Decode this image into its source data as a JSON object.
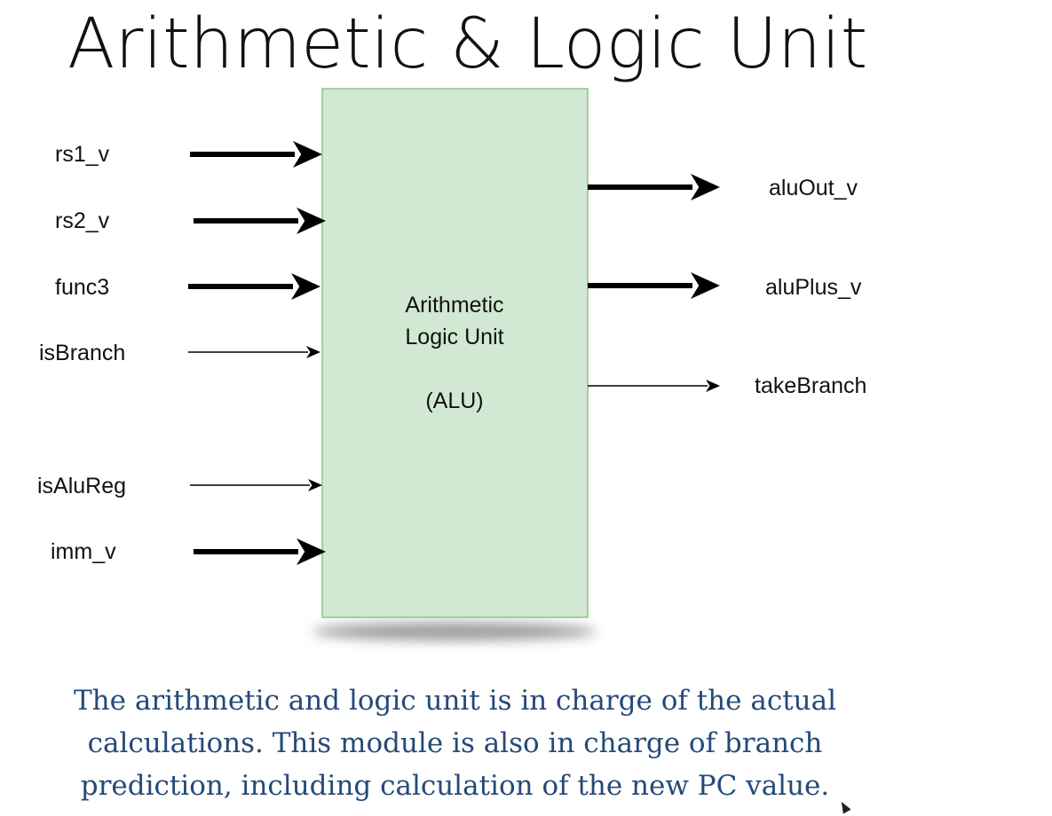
{
  "title": "Arithmetic & Logic Unit",
  "diagram": {
    "box_lines": [
      "Arithmetic",
      "Logic Unit",
      "(ALU)"
    ],
    "inputs": [
      {
        "label": "rs1_v",
        "bus": true
      },
      {
        "label": "rs2_v",
        "bus": true
      },
      {
        "label": "func3",
        "bus": true
      },
      {
        "label": "isBranch",
        "bus": false
      },
      {
        "label": "isAluReg",
        "bus": false
      },
      {
        "label": "imm_v",
        "bus": true
      }
    ],
    "outputs": [
      {
        "label": "aluOut_v",
        "bus": true
      },
      {
        "label": "aluPlus_v",
        "bus": true
      },
      {
        "label": "takeBranch",
        "bus": false
      }
    ],
    "colors": {
      "box_fill": "#d1e9d2",
      "box_stroke": "#8cc48c",
      "arrow": "#000000"
    }
  },
  "caption": {
    "lines": [
      "The arithmetic and logic unit is in charge of the actual",
      "calculations. This module is also in charge of branch",
      "prediction, including calculation of the new PC value."
    ],
    "color": "#244a78"
  }
}
